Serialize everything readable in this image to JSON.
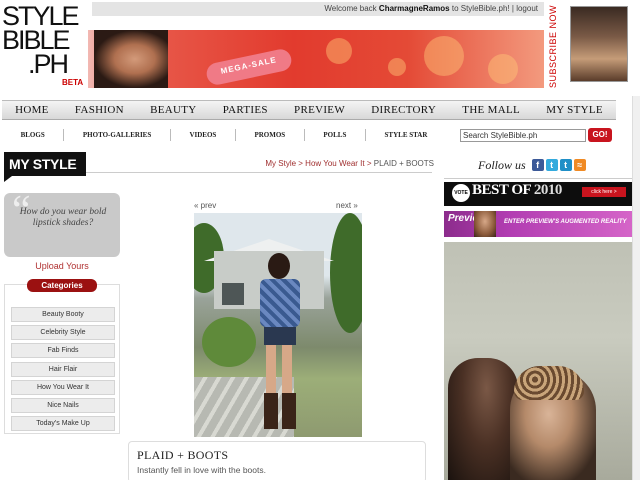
{
  "header": {
    "logo_lines": [
      "STYLE",
      "BIBLE",
      ".PH"
    ],
    "logo_beta": "BETA",
    "welcome_prefix": "Welcome back",
    "welcome_user": "CharmagneRamos",
    "welcome_suffix": "to StyleBible.ph!",
    "separator": "|",
    "logout_label": "logout",
    "subscribe_label": "SUBSCRIBE NOW",
    "banner_pill_text": "MEGA-SALE"
  },
  "main_nav": {
    "items": [
      "HOME",
      "FASHION",
      "BEAUTY",
      "PARTIES",
      "PREVIEW",
      "DIRECTORY",
      "THE MALL",
      "MY STYLE"
    ]
  },
  "sub_nav": {
    "items": [
      "BLOGS",
      "PHOTO-GALLERIES",
      "VIDEOS",
      "PROMOS",
      "POLLS",
      "STYLE STAR"
    ]
  },
  "search": {
    "value": "Search StyleBible.ph",
    "button_label": "GO!"
  },
  "section": {
    "title": "MY STYLE",
    "breadcrumb_links": [
      "My Style",
      "How You Wear It"
    ],
    "breadcrumb_sep": " > ",
    "breadcrumb_current": "PLAID + BOOTS"
  },
  "sidebar": {
    "quote": "How do you wear bold lipstick shades?",
    "upload_label": "Upload Yours",
    "categories_header": "Categories",
    "categories": [
      "Beauty Booty",
      "Celebrity Style",
      "Fab Finds",
      "Hair Flair",
      "How You Wear It",
      "Nice Nails",
      "Today's Make Up"
    ]
  },
  "post": {
    "prev_label": "« prev",
    "next_label": "next »",
    "title": "PLAID + BOOTS",
    "caption": "Instantly fell in love with the boots."
  },
  "right": {
    "follow_label": "Follow us",
    "social_icons": [
      "facebook-icon",
      "twitter-icon",
      "twitter-alt-icon",
      "rss-icon"
    ],
    "best_banner": {
      "vote": "VOTE",
      "prefix": "BEST OF ",
      "year": "2010",
      "button": "click here >"
    },
    "preview_banner": {
      "logo": "Preview",
      "text": "ENTER PREVIEW'S AUGMENTED REALITY"
    }
  },
  "colors": {
    "accent_red": "#c8141e",
    "dark_red": "#9b1111",
    "link_red": "#b03030",
    "nav_gray": "#d8d8d8"
  }
}
